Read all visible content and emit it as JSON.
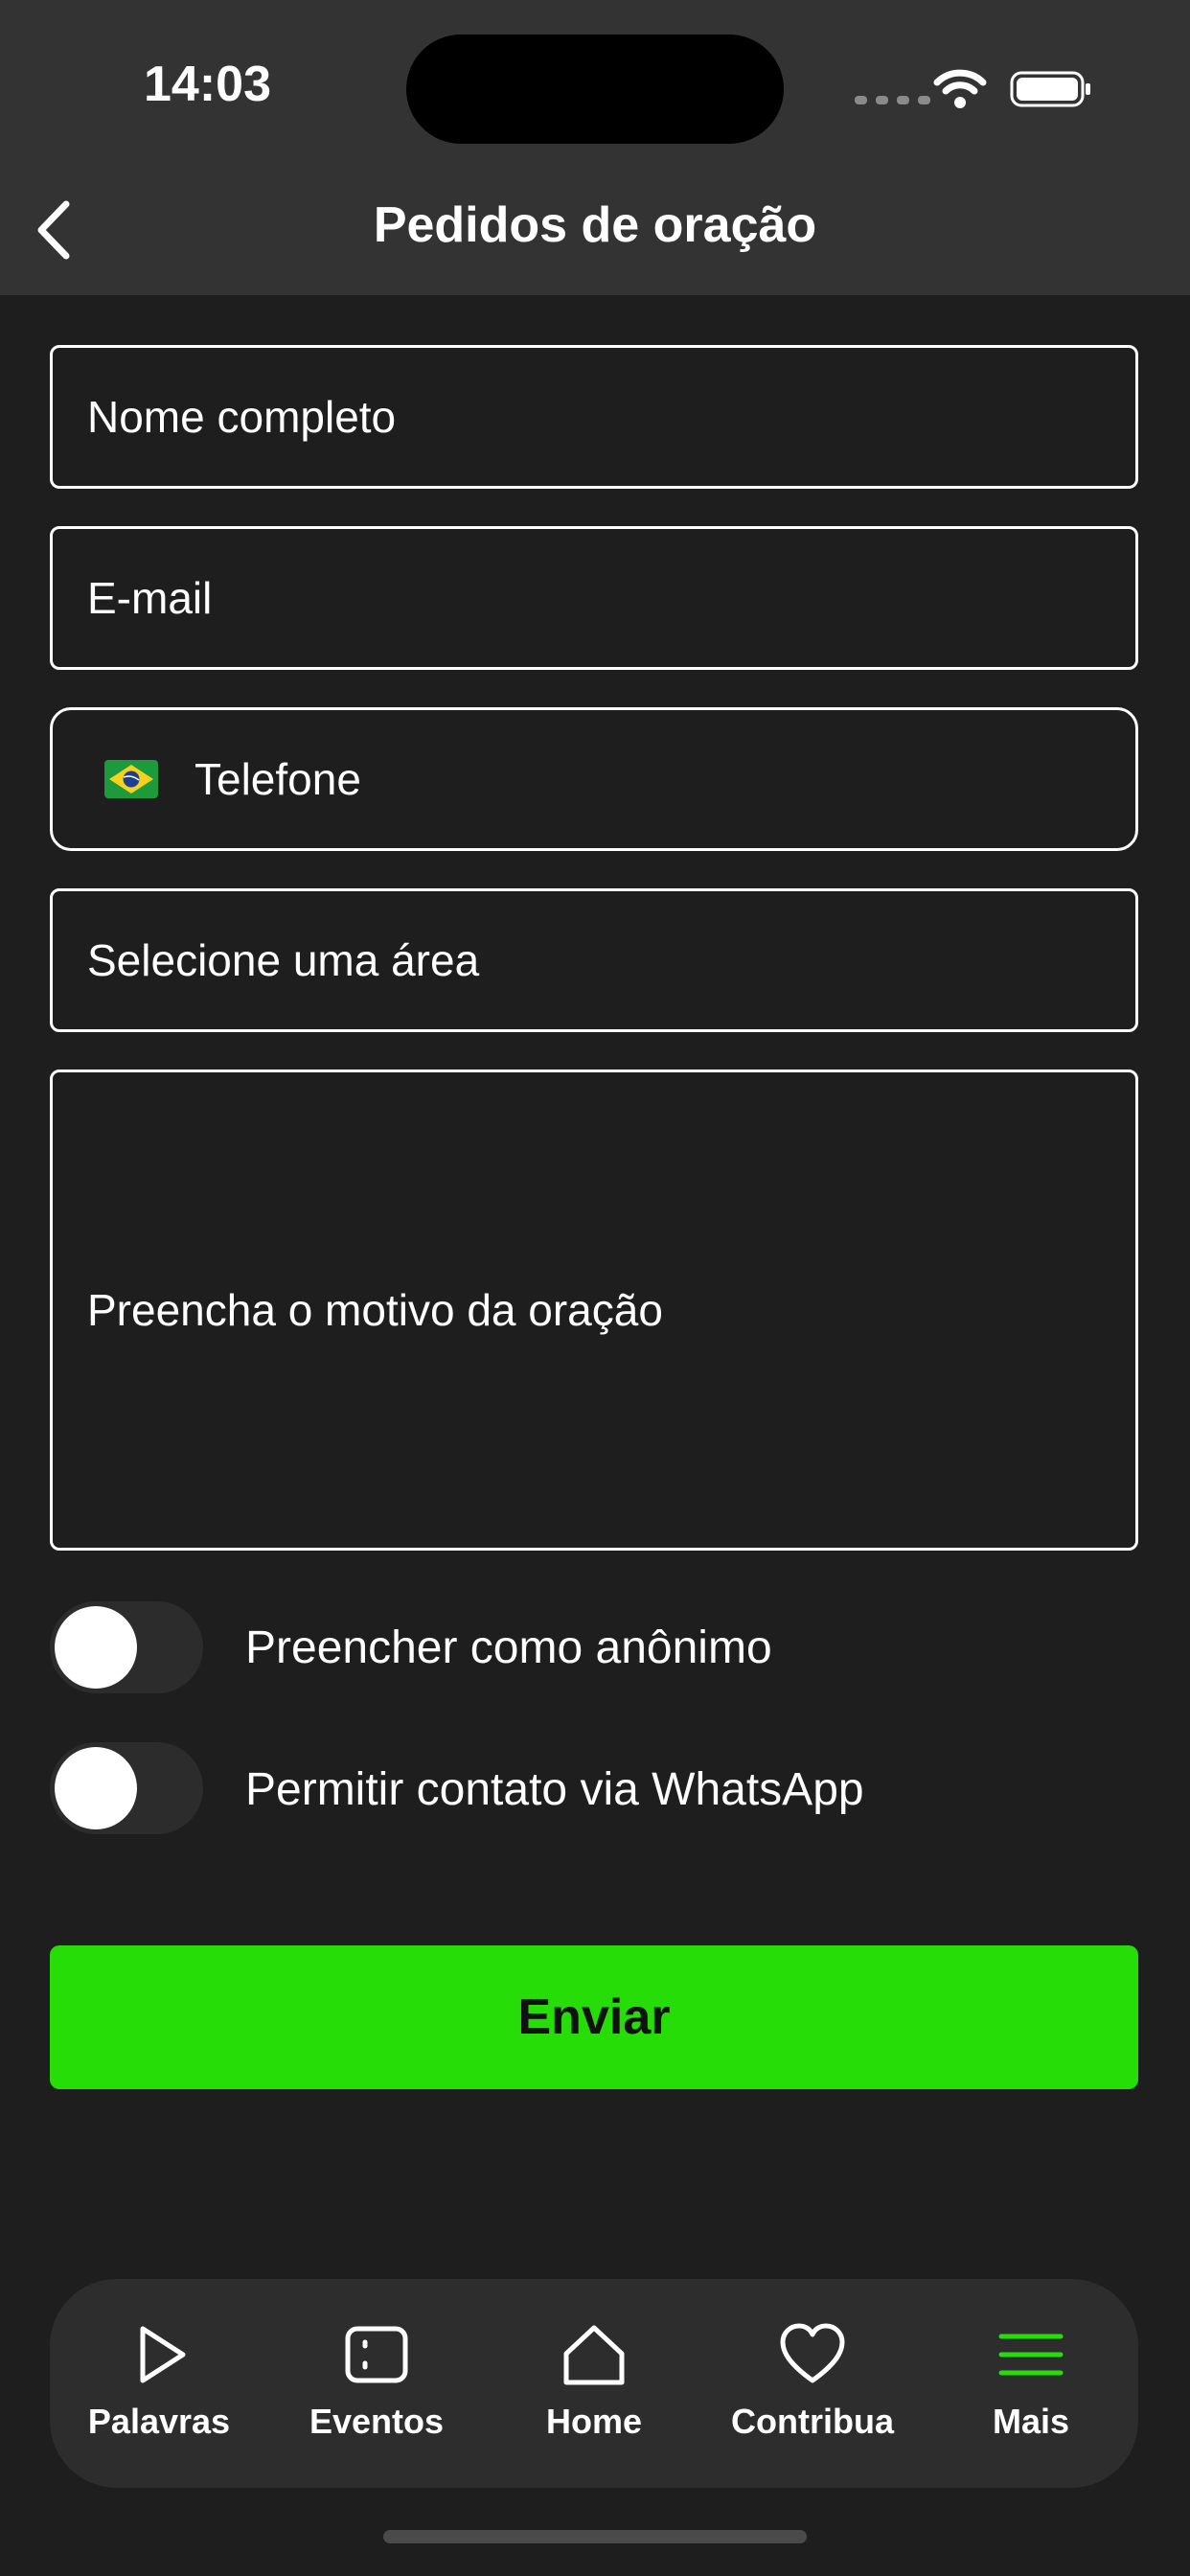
{
  "status_bar": {
    "time": "14:03"
  },
  "header": {
    "title": "Pedidos de oração"
  },
  "form": {
    "name_placeholder": "Nome completo",
    "email_placeholder": "E-mail",
    "phone_placeholder": "Telefone",
    "area_placeholder": "Selecione uma área",
    "reason_placeholder": "Preencha o motivo da oração",
    "toggle_anonymous_label": "Preencher como anônimo",
    "toggle_whatsapp_label": "Permitir contato via WhatsApp",
    "toggle_anonymous_on": false,
    "toggle_whatsapp_on": false,
    "submit_label": "Enviar"
  },
  "tabbar": {
    "items": [
      {
        "label": "Palavras",
        "icon": "play-icon"
      },
      {
        "label": "Eventos",
        "icon": "calendar-icon"
      },
      {
        "label": "Home",
        "icon": "home-icon"
      },
      {
        "label": "Contribua",
        "icon": "heart-icon"
      },
      {
        "label": "Mais",
        "icon": "menu-icon",
        "active": true
      }
    ]
  },
  "colors": {
    "accent": "#27dd07",
    "background": "#1e1e1e",
    "header": "#333333"
  }
}
